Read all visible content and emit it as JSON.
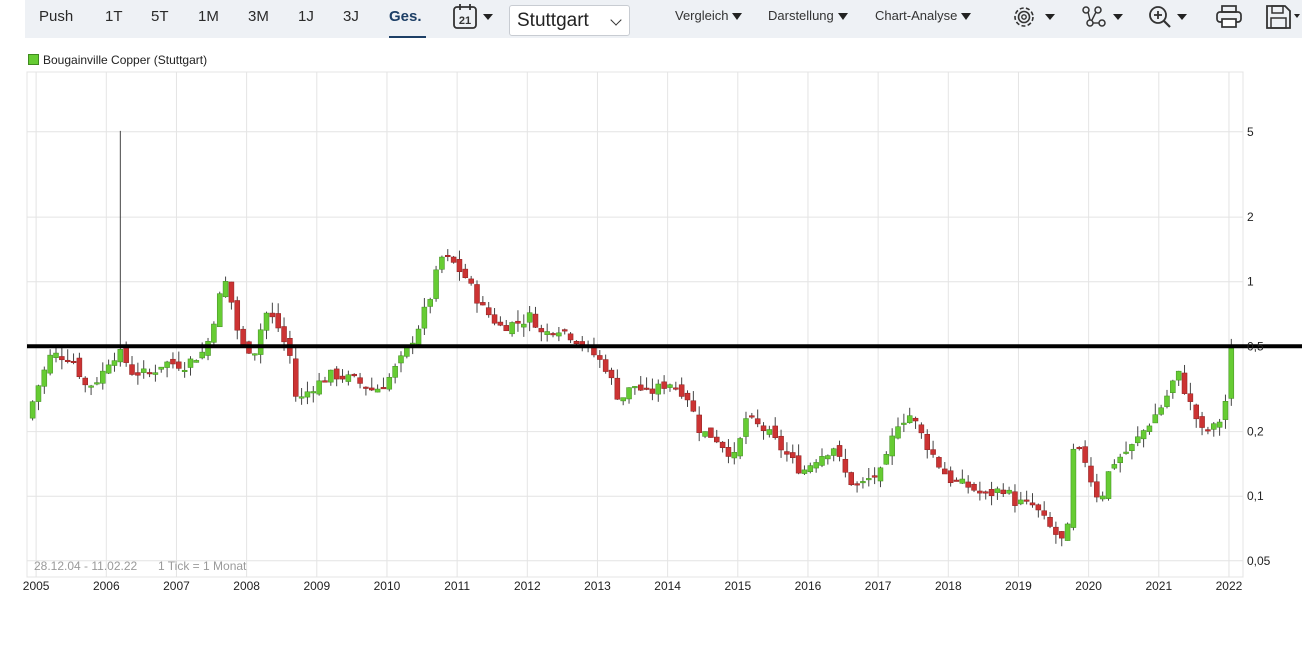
{
  "toolbar": {
    "ranges": [
      "Push",
      "1T",
      "5T",
      "1M",
      "3M",
      "1J",
      "3J",
      "Ges."
    ],
    "active_range": "Ges.",
    "calendar_day": "21",
    "exchange": "Stuttgart",
    "compare_label": "Vergleich",
    "display_label": "Darstellung",
    "analysis_label": "Chart-Analyse",
    "icons": [
      "calendar-icon",
      "settings-icon",
      "indicators-icon",
      "zoom-icon",
      "print-icon",
      "save-icon"
    ]
  },
  "legend": {
    "label": "Bougainville Copper (Stuttgart)",
    "color": "#66cc33"
  },
  "footer": {
    "range_text": "28.12.04 - 11.02.22",
    "tick_text": "1 Tick = 1 Monat"
  },
  "colors": {
    "up": "#66cc33",
    "down": "#cc3333",
    "grid": "#e4e4e4",
    "hline": "#000000",
    "active_tab": "#1d3f66"
  },
  "chart_data": {
    "type": "candlestick",
    "title": "",
    "scale": "log",
    "ylim": [
      0.042,
      9.5
    ],
    "xlim": [
      2004.87,
      2022.2
    ],
    "y_ticks": [
      0.05,
      0.1,
      0.2,
      0.5,
      1,
      2,
      5
    ],
    "y_tick_labels": [
      "0,05",
      "0,1",
      "0,2",
      "0,5",
      "1",
      "2",
      "5"
    ],
    "x_ticks": [
      2005,
      2006,
      2007,
      2008,
      2009,
      2010,
      2011,
      2012,
      2013,
      2014,
      2015,
      2016,
      2017,
      2018,
      2019,
      2020,
      2021,
      2022
    ],
    "x_tick_labels": [
      "2005",
      "2006",
      "2007",
      "2008",
      "2009",
      "2010",
      "2011",
      "2012",
      "2013",
      "2014",
      "2015",
      "2016",
      "2017",
      "2018",
      "2019",
      "2020",
      "2021",
      "2022"
    ],
    "grid": true,
    "horizontal_line": 0.5,
    "series_name": "Bougainville Copper (Stuttgart)",
    "anchors": [
      [
        2004.95,
        0.23
      ],
      [
        2005.1,
        0.32
      ],
      [
        2005.3,
        0.46
      ],
      [
        2005.6,
        0.44
      ],
      [
        2005.8,
        0.32
      ],
      [
        2006.0,
        0.36
      ],
      [
        2006.15,
        0.45
      ],
      [
        2006.3,
        0.46
      ],
      [
        2006.45,
        0.38
      ],
      [
        2006.7,
        0.37
      ],
      [
        2006.9,
        0.42
      ],
      [
        2007.2,
        0.41
      ],
      [
        2007.5,
        0.48
      ],
      [
        2007.7,
        0.85
      ],
      [
        2007.8,
        1.02
      ],
      [
        2008.0,
        0.5
      ],
      [
        2008.2,
        0.48
      ],
      [
        2008.35,
        0.72
      ],
      [
        2008.5,
        0.65
      ],
      [
        2008.7,
        0.45
      ],
      [
        2008.8,
        0.27
      ],
      [
        2009.0,
        0.32
      ],
      [
        2009.3,
        0.37
      ],
      [
        2009.6,
        0.35
      ],
      [
        2009.9,
        0.31
      ],
      [
        2010.1,
        0.35
      ],
      [
        2010.3,
        0.44
      ],
      [
        2010.5,
        0.58
      ],
      [
        2010.7,
        0.85
      ],
      [
        2010.85,
        1.3
      ],
      [
        2011.0,
        1.25
      ],
      [
        2011.2,
        1.05
      ],
      [
        2011.45,
        0.75
      ],
      [
        2011.7,
        0.62
      ],
      [
        2012.0,
        0.65
      ],
      [
        2012.15,
        0.7
      ],
      [
        2012.3,
        0.56
      ],
      [
        2012.5,
        0.62
      ],
      [
        2012.75,
        0.55
      ],
      [
        2013.0,
        0.47
      ],
      [
        2013.2,
        0.4
      ],
      [
        2013.4,
        0.28
      ],
      [
        2013.6,
        0.33
      ],
      [
        2013.8,
        0.3
      ],
      [
        2014.1,
        0.34
      ],
      [
        2014.35,
        0.3
      ],
      [
        2014.55,
        0.2
      ],
      [
        2014.75,
        0.19
      ],
      [
        2015.05,
        0.15
      ],
      [
        2015.2,
        0.23
      ],
      [
        2015.5,
        0.2
      ],
      [
        2015.75,
        0.16
      ],
      [
        2016.0,
        0.13
      ],
      [
        2016.2,
        0.15
      ],
      [
        2016.45,
        0.17
      ],
      [
        2016.65,
        0.12
      ],
      [
        2016.8,
        0.11
      ],
      [
        2016.95,
        0.12
      ],
      [
        2017.15,
        0.13
      ],
      [
        2017.35,
        0.22
      ],
      [
        2017.55,
        0.24
      ],
      [
        2017.75,
        0.18
      ],
      [
        2017.95,
        0.14
      ],
      [
        2018.1,
        0.12
      ],
      [
        2018.4,
        0.11
      ],
      [
        2018.6,
        0.1
      ],
      [
        2018.9,
        0.11
      ],
      [
        2019.0,
        0.095
      ],
      [
        2019.3,
        0.09
      ],
      [
        2019.55,
        0.07
      ],
      [
        2019.7,
        0.062
      ],
      [
        2019.8,
        0.072
      ],
      [
        2019.85,
        0.16
      ],
      [
        2020.0,
        0.16
      ],
      [
        2020.15,
        0.11
      ],
      [
        2020.25,
        0.095
      ],
      [
        2020.4,
        0.14
      ],
      [
        2020.7,
        0.17
      ],
      [
        2020.95,
        0.22
      ],
      [
        2021.15,
        0.27
      ],
      [
        2021.35,
        0.38
      ],
      [
        2021.55,
        0.26
      ],
      [
        2021.7,
        0.2
      ],
      [
        2021.9,
        0.21
      ],
      [
        2022.02,
        0.25
      ],
      [
        2022.1,
        0.47
      ]
    ],
    "long_wick": {
      "x": 2006.17,
      "high": 5.05
    }
  }
}
